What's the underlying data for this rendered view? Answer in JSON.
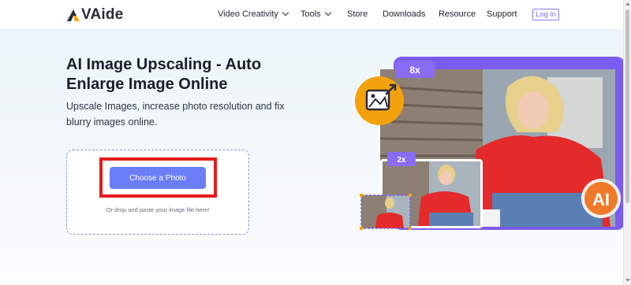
{
  "header": {
    "logo_text": "VAide",
    "nav": [
      {
        "label": "Video Creativity",
        "dropdown": true
      },
      {
        "label": "Tools",
        "dropdown": true
      },
      {
        "label": "Store",
        "dropdown": false
      },
      {
        "label": "Downloads",
        "dropdown": false
      },
      {
        "label": "Resource",
        "dropdown": false
      },
      {
        "label": "Support",
        "dropdown": false
      }
    ],
    "login_label": "Log in"
  },
  "hero": {
    "title": "AI Image Upscaling - Auto Enlarge Image Online",
    "subtitle": "Upscale Images, increase photo resolution and fix blurry images online."
  },
  "upload": {
    "button_label": "Choose a Photo",
    "drop_text": "Or drop and paste your image file here!"
  },
  "illustration": {
    "badge_8x": "8x",
    "badge_2x": "2x",
    "ai_badge": "AI",
    "icon": "image-upscale-icon"
  },
  "colors": {
    "accent": "#6b7df7",
    "highlight": "#e41b1b",
    "purple": "#7b5cf0",
    "orange": "#f4a20c"
  }
}
